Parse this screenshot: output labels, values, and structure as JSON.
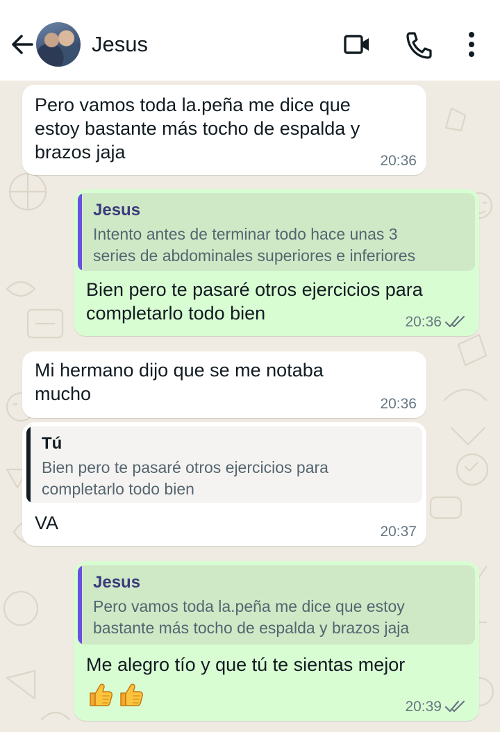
{
  "header": {
    "contact_name": "Jesus",
    "icons": [
      "back-arrow-icon",
      "avatar",
      "video-call-icon",
      "phone-call-icon",
      "more-vert-icon"
    ]
  },
  "colors": {
    "incoming_bubble": "#ffffff",
    "outgoing_bubble": "#d9fdd3",
    "chat_background": "#efeae2",
    "quote_bar_contact": "#6b4fe0",
    "quote_bar_self": "#111b21"
  },
  "messages": [
    {
      "direction": "incoming",
      "lines": [
        "Pero vamos toda la.peña me dice que",
        "estoy bastante más tocho de espalda y",
        "brazos jaja"
      ],
      "time": "20:36"
    },
    {
      "direction": "outgoing",
      "quote": {
        "author": "Jesus",
        "lines": [
          "Intento antes de terminar todo hace unas 3",
          "series de abdominales superiores e inferiores"
        ]
      },
      "lines": [
        "Bien pero te pasaré otros ejercicios para",
        "completarlo todo bien"
      ],
      "time": "20:36",
      "status": "read-double-check"
    },
    {
      "direction": "incoming",
      "lines": [
        "Mi hermano dijo que se me notaba",
        "mucho"
      ],
      "time": "20:36"
    },
    {
      "direction": "incoming",
      "quote": {
        "author": "Tú",
        "lines": [
          "Bien pero te pasaré otros ejercicios para",
          "completarlo todo bien"
        ]
      },
      "lines": [
        "VA"
      ],
      "time": "20:37"
    },
    {
      "direction": "outgoing",
      "quote": {
        "author": "Jesus",
        "lines": [
          "Pero vamos toda la.peña me dice que estoy",
          "bastante más tocho de espalda y brazos jaja"
        ]
      },
      "lines": [
        "Me alegro tío y que tú te sientas mejor"
      ],
      "emojis": [
        "thumbs-up",
        "thumbs-up"
      ],
      "time": "20:39",
      "status": "read-double-check"
    }
  ]
}
